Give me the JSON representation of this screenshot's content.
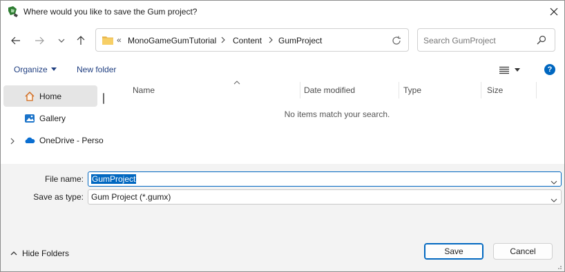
{
  "window": {
    "title": "Where would you like to save the Gum project?"
  },
  "nav": {
    "back_icon": "arrow-left-icon",
    "forward_icon": "arrow-right-icon",
    "recent_icon": "chevron-down-icon",
    "up_icon": "arrow-up-icon"
  },
  "address": {
    "overflow": "«",
    "crumbs": [
      "MonoGameGumTutorial",
      "Content",
      "GumProject"
    ]
  },
  "search": {
    "placeholder": "Search GumProject"
  },
  "toolbar": {
    "organize_label": "Organize",
    "new_folder_label": "New folder"
  },
  "sidebar": {
    "items": [
      {
        "label": "Home",
        "icon": "home-icon",
        "selected": true
      },
      {
        "label": "Gallery",
        "icon": "gallery-icon",
        "selected": false
      },
      {
        "label": "OneDrive - Perso",
        "icon": "onedrive-icon",
        "selected": false
      }
    ]
  },
  "columns": {
    "name": "Name",
    "date_modified": "Date modified",
    "type": "Type",
    "size": "Size"
  },
  "content": {
    "empty_message": "No items match your search."
  },
  "form": {
    "file_name_label": "File name:",
    "file_name_value": "GumProject",
    "save_as_type_label": "Save as type:",
    "save_as_type_value": "Gum Project (*.gumx)"
  },
  "footer": {
    "hide_folders_label": "Hide Folders",
    "save_label": "Save",
    "cancel_label": "Cancel"
  },
  "colors": {
    "accent": "#0067c0",
    "link": "#1f3e80",
    "form_bg": "#f3f3f3"
  }
}
